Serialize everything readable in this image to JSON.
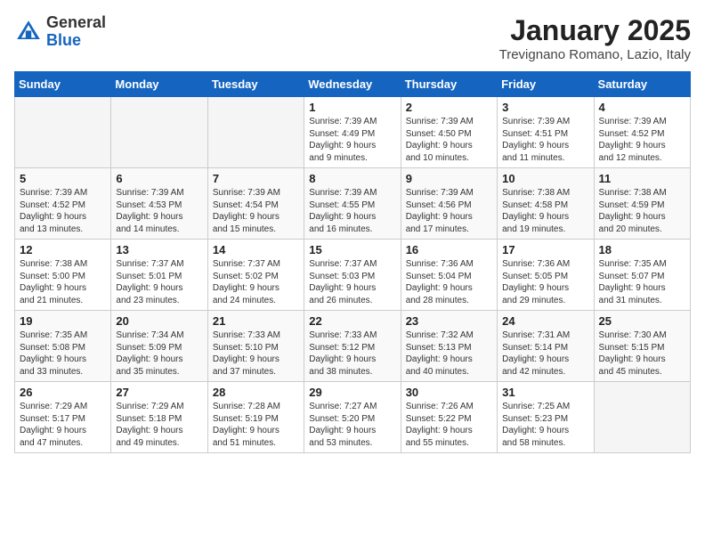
{
  "header": {
    "logo_general": "General",
    "logo_blue": "Blue",
    "title": "January 2025",
    "subtitle": "Trevignano Romano, Lazio, Italy"
  },
  "days_of_week": [
    "Sunday",
    "Monday",
    "Tuesday",
    "Wednesday",
    "Thursday",
    "Friday",
    "Saturday"
  ],
  "weeks": [
    [
      {
        "day": "",
        "info": ""
      },
      {
        "day": "",
        "info": ""
      },
      {
        "day": "",
        "info": ""
      },
      {
        "day": "1",
        "info": "Sunrise: 7:39 AM\nSunset: 4:49 PM\nDaylight: 9 hours\nand 9 minutes."
      },
      {
        "day": "2",
        "info": "Sunrise: 7:39 AM\nSunset: 4:50 PM\nDaylight: 9 hours\nand 10 minutes."
      },
      {
        "day": "3",
        "info": "Sunrise: 7:39 AM\nSunset: 4:51 PM\nDaylight: 9 hours\nand 11 minutes."
      },
      {
        "day": "4",
        "info": "Sunrise: 7:39 AM\nSunset: 4:52 PM\nDaylight: 9 hours\nand 12 minutes."
      }
    ],
    [
      {
        "day": "5",
        "info": "Sunrise: 7:39 AM\nSunset: 4:52 PM\nDaylight: 9 hours\nand 13 minutes."
      },
      {
        "day": "6",
        "info": "Sunrise: 7:39 AM\nSunset: 4:53 PM\nDaylight: 9 hours\nand 14 minutes."
      },
      {
        "day": "7",
        "info": "Sunrise: 7:39 AM\nSunset: 4:54 PM\nDaylight: 9 hours\nand 15 minutes."
      },
      {
        "day": "8",
        "info": "Sunrise: 7:39 AM\nSunset: 4:55 PM\nDaylight: 9 hours\nand 16 minutes."
      },
      {
        "day": "9",
        "info": "Sunrise: 7:39 AM\nSunset: 4:56 PM\nDaylight: 9 hours\nand 17 minutes."
      },
      {
        "day": "10",
        "info": "Sunrise: 7:38 AM\nSunset: 4:58 PM\nDaylight: 9 hours\nand 19 minutes."
      },
      {
        "day": "11",
        "info": "Sunrise: 7:38 AM\nSunset: 4:59 PM\nDaylight: 9 hours\nand 20 minutes."
      }
    ],
    [
      {
        "day": "12",
        "info": "Sunrise: 7:38 AM\nSunset: 5:00 PM\nDaylight: 9 hours\nand 21 minutes."
      },
      {
        "day": "13",
        "info": "Sunrise: 7:37 AM\nSunset: 5:01 PM\nDaylight: 9 hours\nand 23 minutes."
      },
      {
        "day": "14",
        "info": "Sunrise: 7:37 AM\nSunset: 5:02 PM\nDaylight: 9 hours\nand 24 minutes."
      },
      {
        "day": "15",
        "info": "Sunrise: 7:37 AM\nSunset: 5:03 PM\nDaylight: 9 hours\nand 26 minutes."
      },
      {
        "day": "16",
        "info": "Sunrise: 7:36 AM\nSunset: 5:04 PM\nDaylight: 9 hours\nand 28 minutes."
      },
      {
        "day": "17",
        "info": "Sunrise: 7:36 AM\nSunset: 5:05 PM\nDaylight: 9 hours\nand 29 minutes."
      },
      {
        "day": "18",
        "info": "Sunrise: 7:35 AM\nSunset: 5:07 PM\nDaylight: 9 hours\nand 31 minutes."
      }
    ],
    [
      {
        "day": "19",
        "info": "Sunrise: 7:35 AM\nSunset: 5:08 PM\nDaylight: 9 hours\nand 33 minutes."
      },
      {
        "day": "20",
        "info": "Sunrise: 7:34 AM\nSunset: 5:09 PM\nDaylight: 9 hours\nand 35 minutes."
      },
      {
        "day": "21",
        "info": "Sunrise: 7:33 AM\nSunset: 5:10 PM\nDaylight: 9 hours\nand 37 minutes."
      },
      {
        "day": "22",
        "info": "Sunrise: 7:33 AM\nSunset: 5:12 PM\nDaylight: 9 hours\nand 38 minutes."
      },
      {
        "day": "23",
        "info": "Sunrise: 7:32 AM\nSunset: 5:13 PM\nDaylight: 9 hours\nand 40 minutes."
      },
      {
        "day": "24",
        "info": "Sunrise: 7:31 AM\nSunset: 5:14 PM\nDaylight: 9 hours\nand 42 minutes."
      },
      {
        "day": "25",
        "info": "Sunrise: 7:30 AM\nSunset: 5:15 PM\nDaylight: 9 hours\nand 45 minutes."
      }
    ],
    [
      {
        "day": "26",
        "info": "Sunrise: 7:29 AM\nSunset: 5:17 PM\nDaylight: 9 hours\nand 47 minutes."
      },
      {
        "day": "27",
        "info": "Sunrise: 7:29 AM\nSunset: 5:18 PM\nDaylight: 9 hours\nand 49 minutes."
      },
      {
        "day": "28",
        "info": "Sunrise: 7:28 AM\nSunset: 5:19 PM\nDaylight: 9 hours\nand 51 minutes."
      },
      {
        "day": "29",
        "info": "Sunrise: 7:27 AM\nSunset: 5:20 PM\nDaylight: 9 hours\nand 53 minutes."
      },
      {
        "day": "30",
        "info": "Sunrise: 7:26 AM\nSunset: 5:22 PM\nDaylight: 9 hours\nand 55 minutes."
      },
      {
        "day": "31",
        "info": "Sunrise: 7:25 AM\nSunset: 5:23 PM\nDaylight: 9 hours\nand 58 minutes."
      },
      {
        "day": "",
        "info": ""
      }
    ]
  ]
}
